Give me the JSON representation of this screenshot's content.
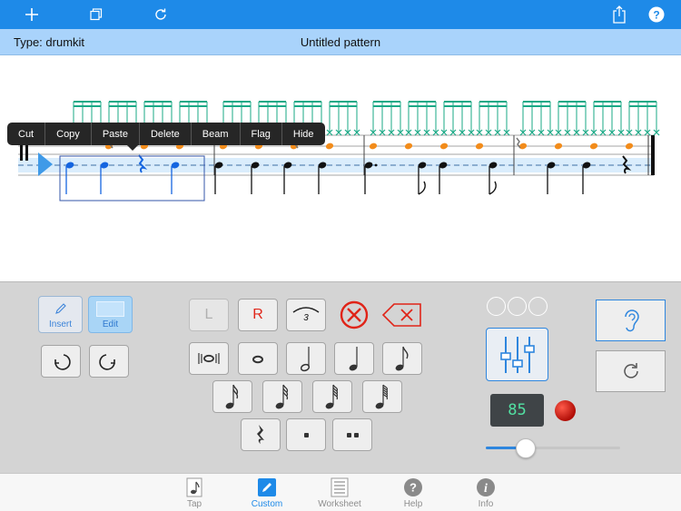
{
  "toolbar": {
    "icons": [
      "plus-icon",
      "duplicate-icon",
      "refresh-icon",
      "share-icon",
      "help-icon"
    ],
    "color": "#1e8ae8"
  },
  "info": {
    "type_text": "Type: drumkit",
    "title": "Untitled pattern"
  },
  "context_menu": {
    "items": [
      "Cut",
      "Copy",
      "Paste",
      "Delete",
      "Beam",
      "Flag",
      "Hide"
    ]
  },
  "edit_modes": {
    "insert_label": "Insert",
    "edit_label": "Edit",
    "active": "Edit"
  },
  "sticking": {
    "left_label": "L",
    "right_label": "R",
    "triplet_label": "3"
  },
  "tempo": {
    "value": "85",
    "volume_level": 0.3
  },
  "tabs": [
    {
      "label": "Tap",
      "icon": "note-page-icon"
    },
    {
      "label": "Custom",
      "icon": "pencil-icon"
    },
    {
      "label": "Worksheet",
      "icon": "worksheet-icon"
    },
    {
      "label": "Help",
      "icon": "help-circle-icon"
    },
    {
      "label": "Info",
      "icon": "info-circle-icon"
    }
  ],
  "active_tab": "Custom",
  "colors": {
    "accent": "#1e8ae8",
    "hihat_notes": "#f28c1b",
    "cymbal_notes": "#1aa986",
    "selected_notes": "#1565e0",
    "info_bar": "#a9d3fb"
  }
}
